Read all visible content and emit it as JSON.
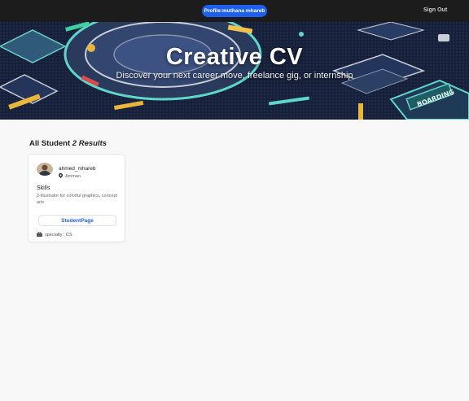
{
  "header": {
    "profile_label": "Profile:muthana mhareb",
    "signout_label": "Sign Out"
  },
  "hero": {
    "title": "Creative CV",
    "subtitle": "Discover your next career move, freelance gig, or internship",
    "sign_text": "BOARDING"
  },
  "results": {
    "heading": "All Student",
    "count": "2 Results"
  },
  "students": [
    {
      "username": "ahmed_mhareb",
      "location": "Amman",
      "skills_title": "Skills",
      "skills": "2-illustrator for colorful graphics, concept arts",
      "button_label": "StudentPage",
      "specialty": "specialty : CS"
    }
  ],
  "colors": {
    "accent": "#1f5ff0",
    "topbar": "#1c1c1c",
    "background": "#f8f8f8"
  },
  "icons": [
    "location-pin-icon",
    "briefcase-icon"
  ]
}
